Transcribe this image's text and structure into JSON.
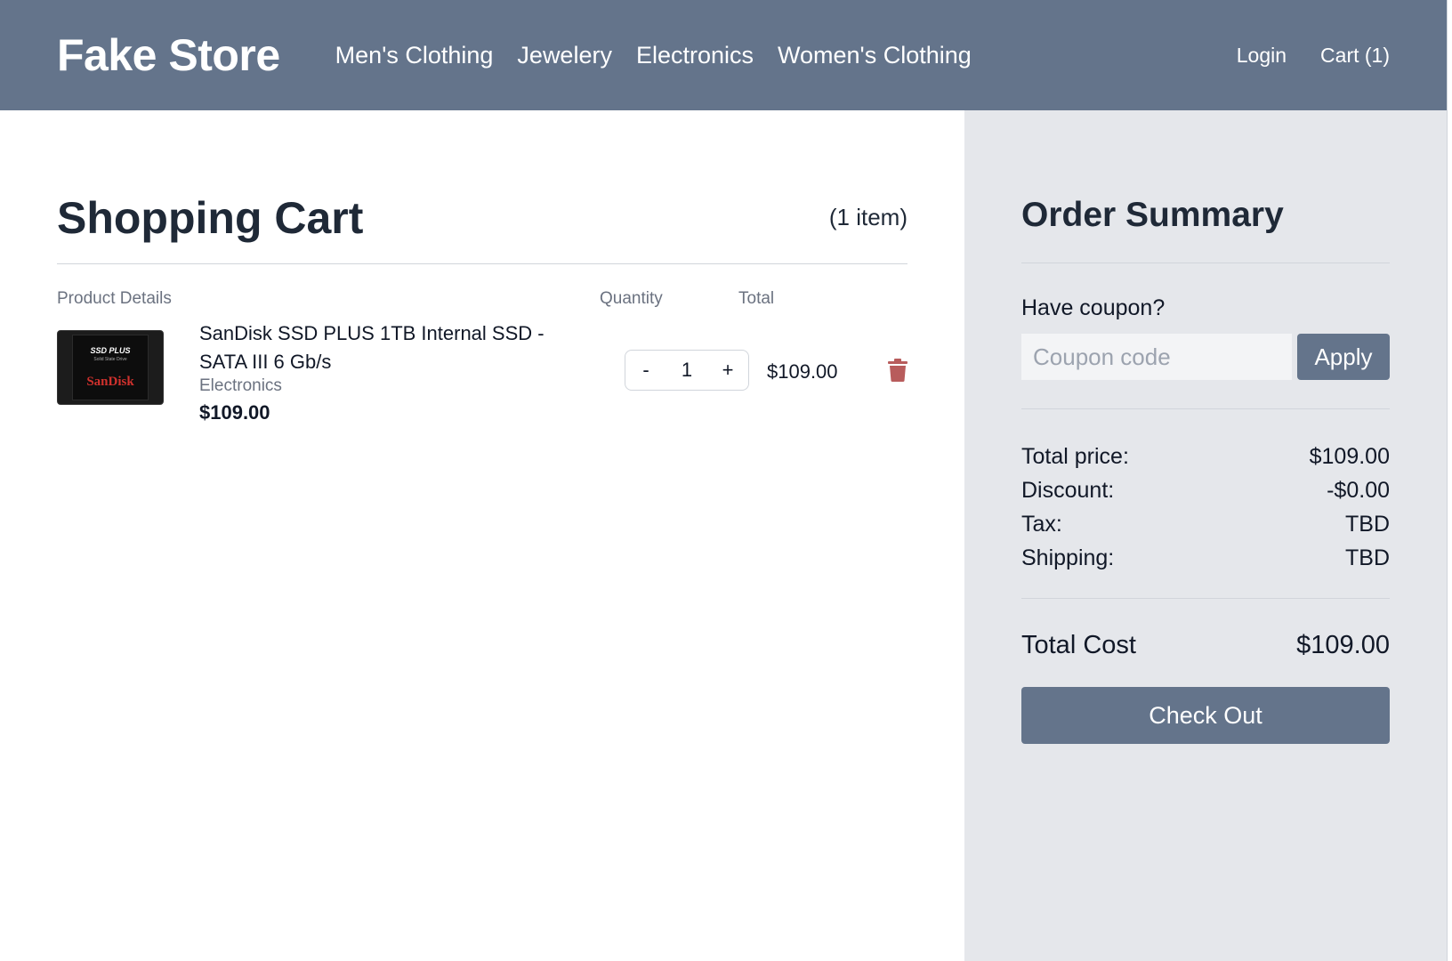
{
  "navbar": {
    "brand": "Fake Store",
    "links": [
      "Men's Clothing",
      "Jewelery",
      "Electronics",
      "Women's Clothing"
    ],
    "login": "Login",
    "cart": "Cart (1)"
  },
  "cart": {
    "title": "Shopping Cart",
    "item_count": "(1 item)",
    "columns": {
      "product_details": "Product Details",
      "quantity": "Quantity",
      "total": "Total"
    },
    "items": [
      {
        "image_text": {
          "model": "SSD PLUS",
          "subtitle": "Solid State Drive",
          "brand": "SanDisk"
        },
        "name": "SanDisk SSD PLUS 1TB Internal SSD - SATA III 6 Gb/s",
        "category": "Electronics",
        "price": "$109.00",
        "qty_minus": "-",
        "quantity": "1",
        "qty_plus": "+",
        "total": "$109.00",
        "delete_icon": "trash-icon"
      }
    ]
  },
  "summary": {
    "title": "Order Summary",
    "coupon_label": "Have coupon?",
    "coupon_placeholder": "Coupon code",
    "apply_label": "Apply",
    "lines": [
      {
        "label": "Total price:",
        "value": "$109.00"
      },
      {
        "label": "Discount:",
        "value": "-$0.00"
      },
      {
        "label": "Tax:",
        "value": "TBD"
      },
      {
        "label": "Shipping:",
        "value": "TBD"
      }
    ],
    "total_label": "Total Cost",
    "total_value": "$109.00",
    "checkout_label": "Check Out"
  },
  "colors": {
    "navbar": "#64748b",
    "summary_bg": "#e5e7eb",
    "button": "#64748b",
    "trash": "#b85c5c"
  }
}
